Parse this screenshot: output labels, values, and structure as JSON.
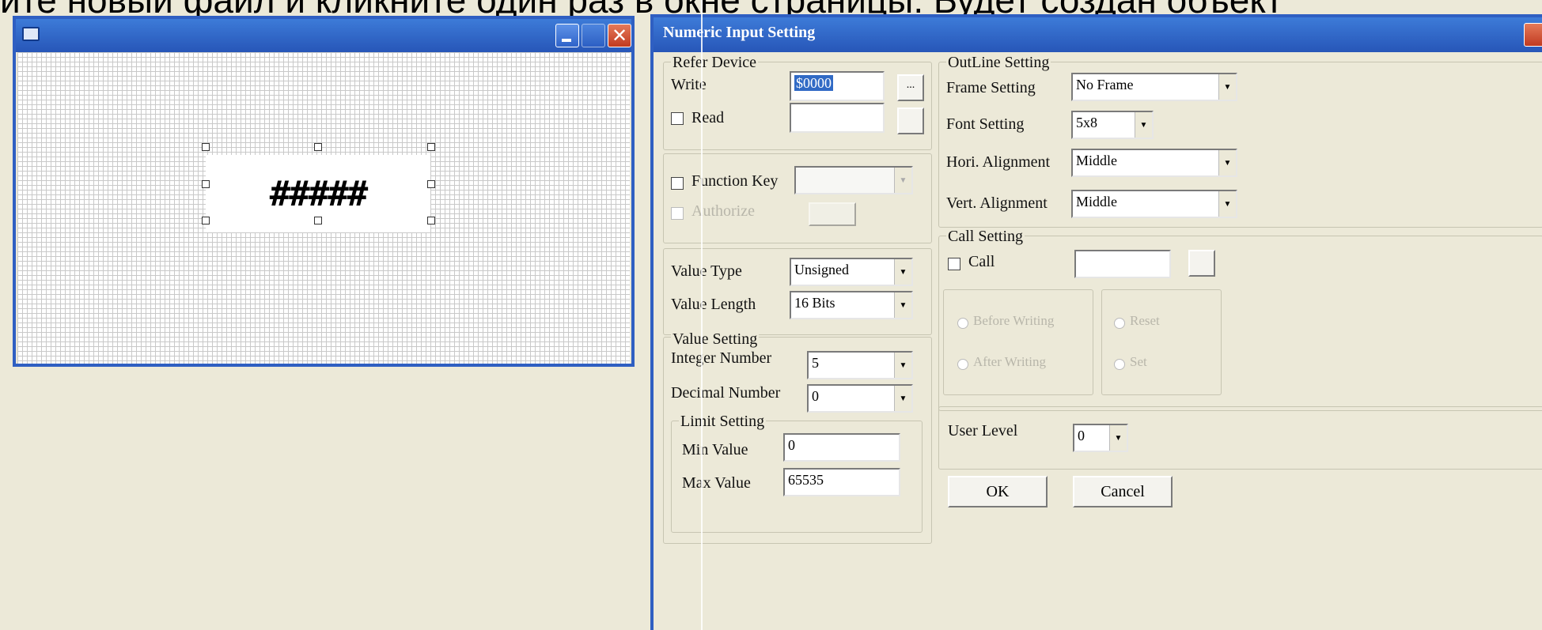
{
  "caption": "ите новый файл и кликните один раз в окне страницы. Будет создан объект",
  "canvas_window": {
    "title": "",
    "object_text": "#####"
  },
  "dialog": {
    "title": "Numeric Input Setting",
    "refer_device": {
      "group_label": "Refer Device",
      "write_label": "Write",
      "write_value": "$0000",
      "read_label": "Read",
      "read_value": "",
      "browse_label": "..."
    },
    "function_key": {
      "label": "Function Key",
      "value": "",
      "authorize_label": "Authorize",
      "authorize_button_label": ""
    },
    "value_type": {
      "label": "Value Type",
      "value": "Unsigned"
    },
    "value_length": {
      "label": "Value Length",
      "value": "16 Bits"
    },
    "value_setting": {
      "group_label": "Value Setting",
      "integer_label": "Integer Number",
      "integer_value": "5",
      "decimal_label": "Decimal Number",
      "decimal_value": "0"
    },
    "limit_setting": {
      "group_label": "Limit Setting",
      "min_label": "Min Value",
      "min_value": "0",
      "max_label": "Max Value",
      "max_value": "65535"
    },
    "outline_setting": {
      "group_label": "OutLine Setting",
      "frame_label": "Frame Setting",
      "frame_value": "No Frame",
      "font_label": "Font Setting",
      "font_value": "5x8",
      "hori_label": "Hori. Alignment",
      "hori_value": "Middle",
      "vert_label": "Vert. Alignment",
      "vert_value": "Middle"
    },
    "call_setting": {
      "group_label": "Call Setting",
      "call_label": "Call",
      "call_value": "",
      "before_writing": "Before Writing",
      "after_writing": "After Writing",
      "reset": "Reset",
      "set": "Set"
    },
    "user_level": {
      "label": "User Level",
      "value": "0"
    },
    "ok_label": "OK",
    "cancel_label": "Cancel"
  }
}
